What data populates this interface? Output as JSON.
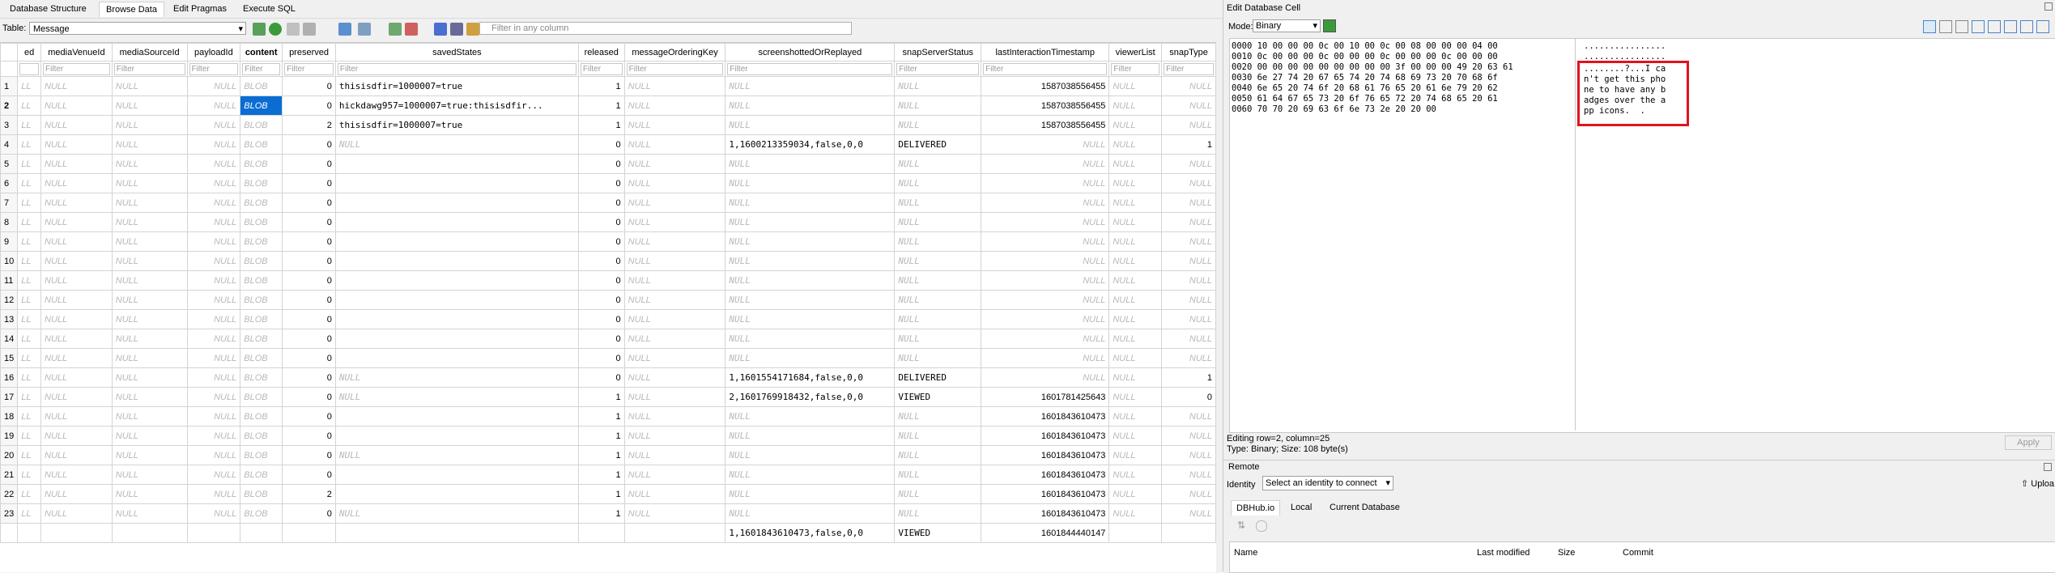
{
  "tabs": [
    "Database Structure",
    "Browse Data",
    "Edit Pragmas",
    "Execute SQL"
  ],
  "toolbar": {
    "table_label": "Table:",
    "table_value": "Message",
    "filter_placeholder": "Filter in any column"
  },
  "grid": {
    "columns": [
      "ed",
      "mediaVenueId",
      "mediaSourceId",
      "payloadId",
      "content",
      "preserved",
      "savedStates",
      "released",
      "messageOrderingKey",
      "screenshottedOrReplayed",
      "snapServerStatus",
      "lastInteractionTimestamp",
      "viewerList",
      "snapType"
    ],
    "filter_label": "Filter",
    "rows": [
      {
        "n": "1",
        "c0": "LL",
        "c1": "NULL",
        "c2": "NULL",
        "c3": "NULL",
        "c4": "BLOB",
        "c5": "0",
        "c6": "thisisdfir=1000007=true",
        "c7": "1",
        "c8": "NULL",
        "c9": "NULL",
        "c10": "NULL",
        "c11": "1587038556455",
        "c12": "NULL",
        "c13": "NULL"
      },
      {
        "n": "2",
        "c0": "LL",
        "c1": "NULL",
        "c2": "NULL",
        "c3": "NULL",
        "c4": "BLOB",
        "c5": "0",
        "c6": "hickdawg957=1000007=true:thisisdfir...",
        "c7": "1",
        "c8": "NULL",
        "c9": "NULL",
        "c10": "NULL",
        "c11": "1587038556455",
        "c12": "NULL",
        "c13": "NULL"
      },
      {
        "n": "3",
        "c0": "LL",
        "c1": "NULL",
        "c2": "NULL",
        "c3": "NULL",
        "c4": "BLOB",
        "c5": "2",
        "c6": "thisisdfir=1000007=true",
        "c7": "1",
        "c8": "NULL",
        "c9": "NULL",
        "c10": "NULL",
        "c11": "1587038556455",
        "c12": "NULL",
        "c13": "NULL"
      },
      {
        "n": "4",
        "c0": "LL",
        "c1": "NULL",
        "c2": "NULL",
        "c3": "NULL",
        "c4": "BLOB",
        "c5": "0",
        "c6": "NULL",
        "c7": "0",
        "c8": "NULL",
        "c9": "1,1600213359034,false,0,0",
        "c10": "DELIVERED",
        "c11": "NULL",
        "c12": "NULL",
        "c13": "1"
      },
      {
        "n": "5",
        "c0": "LL",
        "c1": "NULL",
        "c2": "NULL",
        "c3": "NULL",
        "c4": "BLOB",
        "c5": "0",
        "c6": "",
        "c7": "0",
        "c8": "NULL",
        "c9": "NULL",
        "c10": "NULL",
        "c11": "NULL",
        "c12": "NULL",
        "c13": "NULL"
      },
      {
        "n": "6",
        "c0": "LL",
        "c1": "NULL",
        "c2": "NULL",
        "c3": "NULL",
        "c4": "BLOB",
        "c5": "0",
        "c6": "",
        "c7": "0",
        "c8": "NULL",
        "c9": "NULL",
        "c10": "NULL",
        "c11": "NULL",
        "c12": "NULL",
        "c13": "NULL"
      },
      {
        "n": "7",
        "c0": "LL",
        "c1": "NULL",
        "c2": "NULL",
        "c3": "NULL",
        "c4": "BLOB",
        "c5": "0",
        "c6": "",
        "c7": "0",
        "c8": "NULL",
        "c9": "NULL",
        "c10": "NULL",
        "c11": "NULL",
        "c12": "NULL",
        "c13": "NULL"
      },
      {
        "n": "8",
        "c0": "LL",
        "c1": "NULL",
        "c2": "NULL",
        "c3": "NULL",
        "c4": "BLOB",
        "c5": "0",
        "c6": "",
        "c7": "0",
        "c8": "NULL",
        "c9": "NULL",
        "c10": "NULL",
        "c11": "NULL",
        "c12": "NULL",
        "c13": "NULL"
      },
      {
        "n": "9",
        "c0": "LL",
        "c1": "NULL",
        "c2": "NULL",
        "c3": "NULL",
        "c4": "BLOB",
        "c5": "0",
        "c6": "",
        "c7": "0",
        "c8": "NULL",
        "c9": "NULL",
        "c10": "NULL",
        "c11": "NULL",
        "c12": "NULL",
        "c13": "NULL"
      },
      {
        "n": "10",
        "c0": "LL",
        "c1": "NULL",
        "c2": "NULL",
        "c3": "NULL",
        "c4": "BLOB",
        "c5": "0",
        "c6": "",
        "c7": "0",
        "c8": "NULL",
        "c9": "NULL",
        "c10": "NULL",
        "c11": "NULL",
        "c12": "NULL",
        "c13": "NULL"
      },
      {
        "n": "11",
        "c0": "LL",
        "c1": "NULL",
        "c2": "NULL",
        "c3": "NULL",
        "c4": "BLOB",
        "c5": "0",
        "c6": "",
        "c7": "0",
        "c8": "NULL",
        "c9": "NULL",
        "c10": "NULL",
        "c11": "NULL",
        "c12": "NULL",
        "c13": "NULL"
      },
      {
        "n": "12",
        "c0": "LL",
        "c1": "NULL",
        "c2": "NULL",
        "c3": "NULL",
        "c4": "BLOB",
        "c5": "0",
        "c6": "",
        "c7": "0",
        "c8": "NULL",
        "c9": "NULL",
        "c10": "NULL",
        "c11": "NULL",
        "c12": "NULL",
        "c13": "NULL"
      },
      {
        "n": "13",
        "c0": "LL",
        "c1": "NULL",
        "c2": "NULL",
        "c3": "NULL",
        "c4": "BLOB",
        "c5": "0",
        "c6": "",
        "c7": "0",
        "c8": "NULL",
        "c9": "NULL",
        "c10": "NULL",
        "c11": "NULL",
        "c12": "NULL",
        "c13": "NULL"
      },
      {
        "n": "14",
        "c0": "LL",
        "c1": "NULL",
        "c2": "NULL",
        "c3": "NULL",
        "c4": "BLOB",
        "c5": "0",
        "c6": "",
        "c7": "0",
        "c8": "NULL",
        "c9": "NULL",
        "c10": "NULL",
        "c11": "NULL",
        "c12": "NULL",
        "c13": "NULL"
      },
      {
        "n": "15",
        "c0": "LL",
        "c1": "NULL",
        "c2": "NULL",
        "c3": "NULL",
        "c4": "BLOB",
        "c5": "0",
        "c6": "",
        "c7": "0",
        "c8": "NULL",
        "c9": "NULL",
        "c10": "NULL",
        "c11": "NULL",
        "c12": "NULL",
        "c13": "NULL"
      },
      {
        "n": "16",
        "c0": "LL",
        "c1": "NULL",
        "c2": "NULL",
        "c3": "NULL",
        "c4": "BLOB",
        "c5": "0",
        "c6": "NULL",
        "c7": "0",
        "c8": "NULL",
        "c9": "1,1601554171684,false,0,0",
        "c10": "DELIVERED",
        "c11": "NULL",
        "c12": "NULL",
        "c13": "1"
      },
      {
        "n": "17",
        "c0": "LL",
        "c1": "NULL",
        "c2": "NULL",
        "c3": "NULL",
        "c4": "BLOB",
        "c5": "0",
        "c6": "NULL",
        "c7": "1",
        "c8": "NULL",
        "c9": "2,1601769918432,false,0,0",
        "c10": "VIEWED",
        "c11": "1601781425643",
        "c12": "NULL",
        "c13": "0"
      },
      {
        "n": "18",
        "c0": "LL",
        "c1": "NULL",
        "c2": "NULL",
        "c3": "NULL",
        "c4": "BLOB",
        "c5": "0",
        "c6": "",
        "c7": "1",
        "c8": "NULL",
        "c9": "NULL",
        "c10": "NULL",
        "c11": "1601843610473",
        "c12": "NULL",
        "c13": "NULL"
      },
      {
        "n": "19",
        "c0": "LL",
        "c1": "NULL",
        "c2": "NULL",
        "c3": "NULL",
        "c4": "BLOB",
        "c5": "0",
        "c6": "",
        "c7": "1",
        "c8": "NULL",
        "c9": "NULL",
        "c10": "NULL",
        "c11": "1601843610473",
        "c12": "NULL",
        "c13": "NULL"
      },
      {
        "n": "20",
        "c0": "LL",
        "c1": "NULL",
        "c2": "NULL",
        "c3": "NULL",
        "c4": "BLOB",
        "c5": "0",
        "c6": "NULL",
        "c7": "1",
        "c8": "NULL",
        "c9": "NULL",
        "c10": "NULL",
        "c11": "1601843610473",
        "c12": "NULL",
        "c13": "NULL"
      },
      {
        "n": "21",
        "c0": "LL",
        "c1": "NULL",
        "c2": "NULL",
        "c3": "NULL",
        "c4": "BLOB",
        "c5": "0",
        "c6": "",
        "c7": "1",
        "c8": "NULL",
        "c9": "NULL",
        "c10": "NULL",
        "c11": "1601843610473",
        "c12": "NULL",
        "c13": "NULL"
      },
      {
        "n": "22",
        "c0": "LL",
        "c1": "NULL",
        "c2": "NULL",
        "c3": "NULL",
        "c4": "BLOB",
        "c5": "2",
        "c6": "",
        "c7": "1",
        "c8": "NULL",
        "c9": "NULL",
        "c10": "NULL",
        "c11": "1601843610473",
        "c12": "NULL",
        "c13": "NULL"
      },
      {
        "n": "23",
        "c0": "LL",
        "c1": "NULL",
        "c2": "NULL",
        "c3": "NULL",
        "c4": "BLOB",
        "c5": "0",
        "c6": "NULL",
        "c7": "1",
        "c8": "NULL",
        "c9": "NULL",
        "c10": "NULL",
        "c11": "1601843610473",
        "c12": "NULL",
        "c13": "NULL"
      }
    ],
    "partial_row": {
      "c9": "1,1601843610473,false,0,0",
      "c10": "VIEWED",
      "c11": "1601844440147"
    }
  },
  "cell_editor": {
    "title": "Edit Database Cell",
    "mode_label": "Mode:",
    "mode_value": "Binary",
    "hex_lines": [
      "0000 10 00 00 00 0c 00 10 00 0c 00 08 00 00 00 04 00",
      "0010 0c 00 00 00 0c 00 00 00 0c 00 00 00 0c 00 00 00",
      "0020 00 00 00 00 00 00 00 00 00 3f 00 00 00 49 20 63 61",
      "0030 6e 27 74 20 67 65 74 20 74 68 69 73 20 70 68 6f",
      "0040 6e 65 20 74 6f 20 68 61 76 65 20 61 6e 79 20 62",
      "0050 61 64 67 65 73 20 6f 76 65 72 20 74 68 65 20 61",
      "0060 70 70 20 69 63 6f 6e 73 2e 20 20 00"
    ],
    "ascii_lines": [
      "................",
      "................",
      "........?...I ca",
      "n't get this pho",
      "ne to have any b",
      "adges over the a",
      "pp icons.  ."
    ],
    "status_line1": "Editing row=2, column=25",
    "status_line2": "Type: Binary; Size: 108 byte(s)",
    "apply_label": "Apply"
  },
  "remote": {
    "title": "Remote",
    "identity_label": "Identity",
    "identity_value": "Select an identity to connect",
    "upload_label": "Uploa",
    "tabs": [
      "DBHub.io",
      "Local",
      "Current Database"
    ],
    "list_headers": [
      "Name",
      "Last modified",
      "Size",
      "Commit"
    ]
  }
}
